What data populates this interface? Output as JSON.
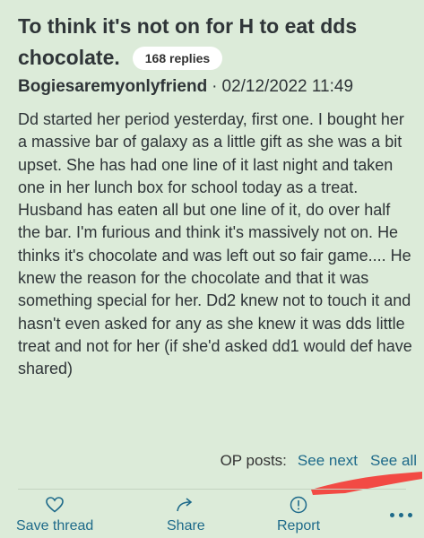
{
  "thread": {
    "title_line1": "To think it's not on for H to eat dds",
    "title_line2": "chocolate.",
    "replies_badge": "168 replies"
  },
  "post": {
    "author": "Bogiesaremyonlyfriend",
    "separator": "·",
    "timestamp": "02/12/2022 11:49",
    "body": "Dd started her period yesterday, first one. I bought her a massive bar of galaxy as a little gift as she was a bit upset. She has had one line of it last night and taken one in her lunch box for school today as a treat. Husband has eaten all but one line of it, do over half the bar. I'm furious and think it's massively not on. He thinks it's chocolate and was left out so fair game.... He knew the reason for the chocolate and that it was something special for her. Dd2 knew not to touch it and hasn't even asked for any as she knew it was dds little treat and not for her (if she'd asked dd1 would def have shared)"
  },
  "op_posts": {
    "label": "OP posts:",
    "see_next": "See next",
    "see_all": "See all"
  },
  "actions": {
    "save": {
      "label": "Save thread",
      "icon": "heart-icon"
    },
    "share": {
      "label": "Share",
      "icon": "share-arrow-icon"
    },
    "report": {
      "label": "Report",
      "icon": "exclamation-circle-icon"
    },
    "more": {
      "icon": "more-dots-icon"
    }
  },
  "colors": {
    "background": "#dcebd9",
    "link": "#1e6a8a",
    "text": "#2f3538",
    "redaction": "#f24a44"
  }
}
